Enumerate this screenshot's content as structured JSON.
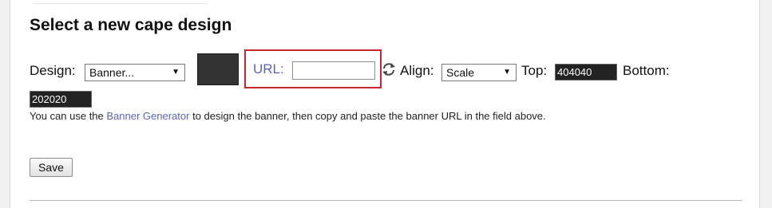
{
  "section": {
    "title": "Select a new cape design"
  },
  "form": {
    "design_label": "Design:",
    "design_value": "Banner...",
    "url_label": "URL:",
    "url_value": "",
    "align_label": "Align:",
    "align_value": "Scale",
    "top_label": "Top:",
    "top_value": "404040",
    "bottom_label": "Bottom:",
    "bottom_value": "202020",
    "save_label": "Save"
  },
  "help": {
    "text_before": "You can use the ",
    "link": "Banner Generator",
    "text_after": " to design the banner, then copy and paste the banner URL in the field above."
  },
  "colors": {
    "link": "#5a64b4",
    "highlight": "#c8262c",
    "swatch": "#333333"
  },
  "icons": {
    "select_arrow": "triangle-down",
    "refresh": "refresh-arrows"
  }
}
